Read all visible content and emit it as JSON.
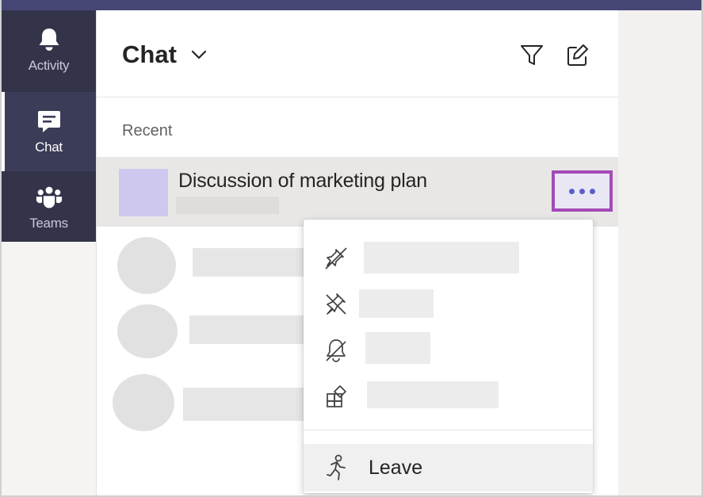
{
  "nav": {
    "items": [
      {
        "label": "Activity",
        "icon": "bell-icon",
        "active": false
      },
      {
        "label": "Chat",
        "icon": "chat-icon",
        "active": true
      },
      {
        "label": "Teams",
        "icon": "teams-icon",
        "active": false
      }
    ]
  },
  "header": {
    "title": "Chat",
    "filter_icon": "filter-icon",
    "compose_icon": "compose-icon"
  },
  "list": {
    "section_label": "Recent",
    "selected_chat": {
      "title": "Discussion of marketing plan",
      "avatar_color": "#cfc8ee"
    }
  },
  "context_menu": {
    "items": [
      {
        "icon": "unpin-icon"
      },
      {
        "icon": "unpin-alt-icon"
      },
      {
        "icon": "mute-icon"
      },
      {
        "icon": "app-add-icon"
      }
    ],
    "leave_label": "Leave",
    "leave_icon": "leave-icon"
  },
  "colors": {
    "topbar": "#464775",
    "rail": "#33344a",
    "accent": "#5b5fc7",
    "highlight_border": "#a44ab7"
  }
}
